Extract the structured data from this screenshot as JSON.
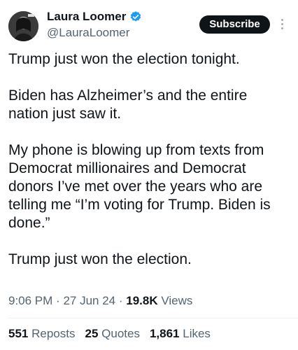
{
  "author": {
    "display_name": "Laura Loomer",
    "handle": "@LauraLoomer",
    "verified": true,
    "avatar_icon": "profile-photo"
  },
  "actions": {
    "subscribe_label": "Subscribe",
    "more_icon": "more-vertical-icon"
  },
  "tweet": {
    "paragraphs": [
      "Trump just won the election tonight.",
      "Biden has Alzheimer’s and the entire nation just saw it.",
      "My phone is blowing up from texts from Democrat millionaires and Democrat donors I’ve met over the years who are telling me “I’m voting for Trump. Biden is done.”",
      "Trump just won the election."
    ]
  },
  "meta": {
    "time": "9:06 PM",
    "date": "27 Jun 24",
    "views_count": "19.8K",
    "views_label": "Views"
  },
  "stats": {
    "reposts_count": "551",
    "reposts_label": "Reposts",
    "quotes_count": "25",
    "quotes_label": "Quotes",
    "likes_count": "1,861",
    "likes_label": "Likes"
  },
  "colors": {
    "text": "#0f1419",
    "secondary": "#536471",
    "verified_badge": "#1d9bf0",
    "subscribe_bg": "#0f1419"
  }
}
